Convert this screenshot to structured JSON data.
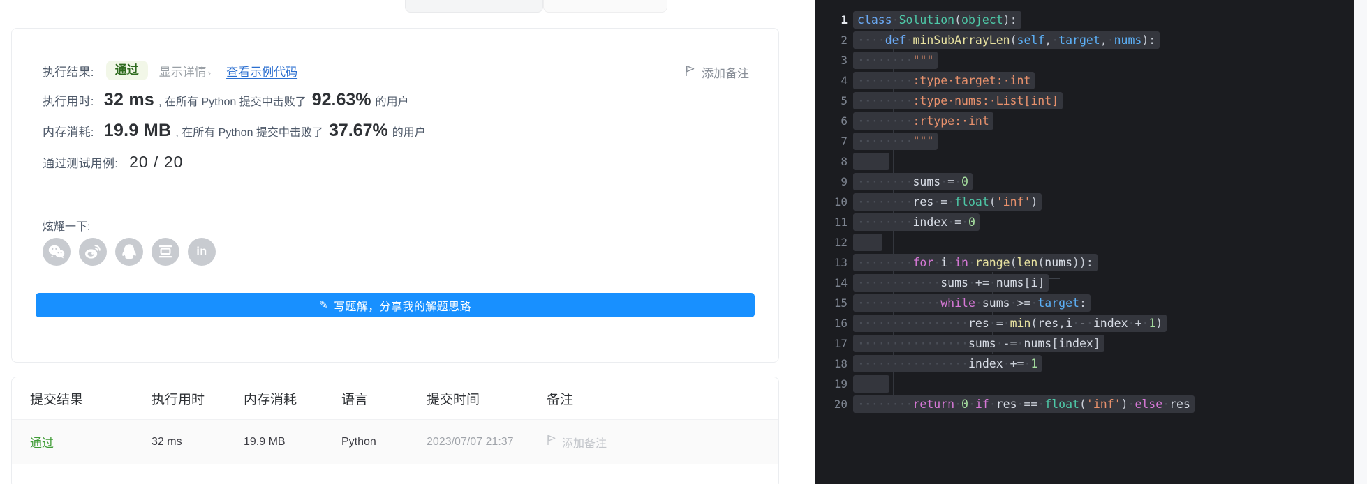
{
  "result": {
    "exec_result_label": "执行结果:",
    "status_badge": "通过",
    "show_detail": "显示详情",
    "show_detail_chevron": "›",
    "sample_code_link": "查看示例代码",
    "add_note": "添加备注",
    "runtime_label": "执行用时:",
    "runtime_value": "32 ms",
    "runtime_mid": ", 在所有 Python 提交中击败了",
    "runtime_pct": "92.63%",
    "runtime_tail": "的用户",
    "memory_label": "内存消耗:",
    "memory_value": "19.9 MB",
    "memory_mid": ", 在所有 Python 提交中击败了",
    "memory_pct": "37.67%",
    "memory_tail": "的用户",
    "cases_label": "通过测试用例:",
    "cases_value": "20 / 20",
    "share_label": "炫耀一下:",
    "share_icons": [
      "wechat-icon",
      "weibo-icon",
      "qq-icon",
      "douban-icon",
      "linkedin-icon"
    ],
    "linkedin_text": "in",
    "write_button": "写题解，分享我的解题思路",
    "write_button_icon": "pencil-icon",
    "accent_color": "#1890ff",
    "pass_color": "#3f9c35",
    "link_color": "#2b6fd0"
  },
  "submissions": {
    "columns": [
      "提交结果",
      "执行用时",
      "内存消耗",
      "语言",
      "提交时间",
      "备注"
    ],
    "rows": [
      {
        "status": "通过",
        "runtime": "32 ms",
        "memory": "19.9 MB",
        "language": "Python",
        "time": "2023/07/07 21:37",
        "note": "添加备注",
        "note_icon": "flag-icon"
      }
    ]
  },
  "editor": {
    "language": "python",
    "line_count": 20,
    "current_line": 1,
    "lines": [
      {
        "n": "1",
        "text": "class Solution(object):"
      },
      {
        "n": "2",
        "text": "    def minSubArrayLen(self, target, nums):"
      },
      {
        "n": "3",
        "text": "        \"\"\""
      },
      {
        "n": "4",
        "text": "        :type target: int"
      },
      {
        "n": "5",
        "text": "        :type nums: List[int]"
      },
      {
        "n": "6",
        "text": "        :rtype: int"
      },
      {
        "n": "7",
        "text": "        \"\"\""
      },
      {
        "n": "8",
        "text": ""
      },
      {
        "n": "9",
        "text": "        sums = 0"
      },
      {
        "n": "10",
        "text": "        res = float('inf')"
      },
      {
        "n": "11",
        "text": "        index = 0"
      },
      {
        "n": "12",
        "text": ""
      },
      {
        "n": "13",
        "text": "        for i in range(len(nums)):"
      },
      {
        "n": "14",
        "text": "            sums += nums[i]"
      },
      {
        "n": "15",
        "text": "            while sums >= target:"
      },
      {
        "n": "16",
        "text": "                res = min(res,i - index + 1)"
      },
      {
        "n": "17",
        "text": "                sums -= nums[index]"
      },
      {
        "n": "18",
        "text": "                index += 1"
      },
      {
        "n": "19",
        "text": ""
      },
      {
        "n": "20",
        "text": "        return 0 if res == float('inf') else res"
      }
    ],
    "bg_color": "#1b1c20"
  }
}
